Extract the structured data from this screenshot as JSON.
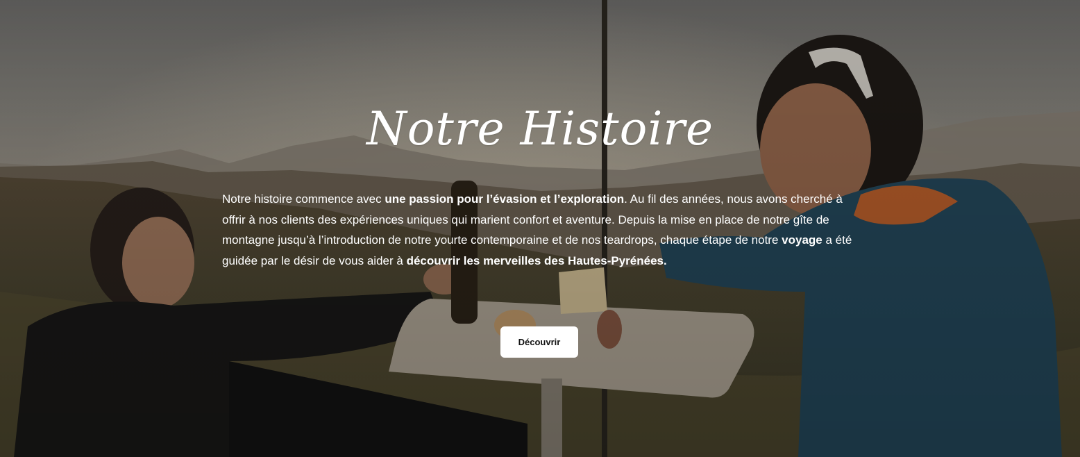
{
  "hero": {
    "title": "Notre Histoire",
    "paragraph": [
      {
        "text": "Notre histoire commence avec ",
        "bold": false
      },
      {
        "text": "une passion pour l’évasion et l’exploration",
        "bold": true
      },
      {
        "text": ". Au fil des années, nous avons cherché à offrir à nos clients des expériences uniques qui marient confort et aventure. Depuis la mise en place de notre gîte de montagne jusqu’à l’introduction de notre yourte contemporaine et de nos teardrops, chaque étape de notre ",
        "bold": false
      },
      {
        "text": "voyage",
        "bold": true
      },
      {
        "text": " a été guidée par le désir de vous aider à ",
        "bold": false
      },
      {
        "text": "découvrir les merveilles des Hautes-Pyrénées.",
        "bold": true
      }
    ],
    "cta_label": "Découvrir"
  },
  "colors": {
    "text": "#ffffff",
    "button_bg": "#ffffff",
    "button_text": "#111111"
  }
}
